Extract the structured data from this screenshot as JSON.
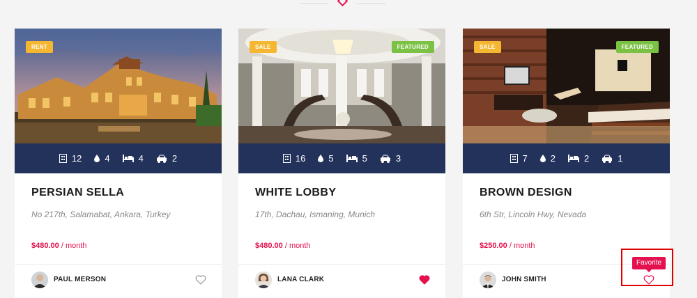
{
  "colors": {
    "accent": "#e4114e",
    "stats_bar": "#23325b",
    "tag_orange": "#f5b731",
    "tag_green": "#7bc144"
  },
  "listings": [
    {
      "status_tag": "RENT",
      "featured_tag": "",
      "stats": {
        "floors": "12",
        "baths": "4",
        "beds": "4",
        "garages": "2"
      },
      "title": "PERSIAN SELLA",
      "address": "No 217th, Salamabat, Ankara, Turkey",
      "price": "$480.00",
      "period": "/ month",
      "agent": "PAUL MERSON",
      "favorited": false
    },
    {
      "status_tag": "SALE",
      "featured_tag": "FEATURED",
      "stats": {
        "floors": "16",
        "baths": "5",
        "beds": "5",
        "garages": "3"
      },
      "title": "WHITE LOBBY",
      "address": "17th, Dachau, Ismaning, Munich",
      "price": "$480.00",
      "period": "/ month",
      "agent": "LANA CLARK",
      "favorited": true
    },
    {
      "status_tag": "SALE",
      "featured_tag": "FEATURED",
      "stats": {
        "floors": "7",
        "baths": "2",
        "beds": "2",
        "garages": "1"
      },
      "title": "BROWN DESIGN",
      "address": "6th Str, Lincoln Hwy, Nevada",
      "price": "$250.00",
      "period": "/ month",
      "agent": "JOHN SMITH",
      "favorited": false
    }
  ],
  "tooltip": {
    "favorite": "Favorite"
  },
  "icons": {
    "floors": "building-icon",
    "baths": "water-drop-icon",
    "beds": "bed-icon",
    "garages": "car-icon",
    "favorite": "heart-icon"
  }
}
